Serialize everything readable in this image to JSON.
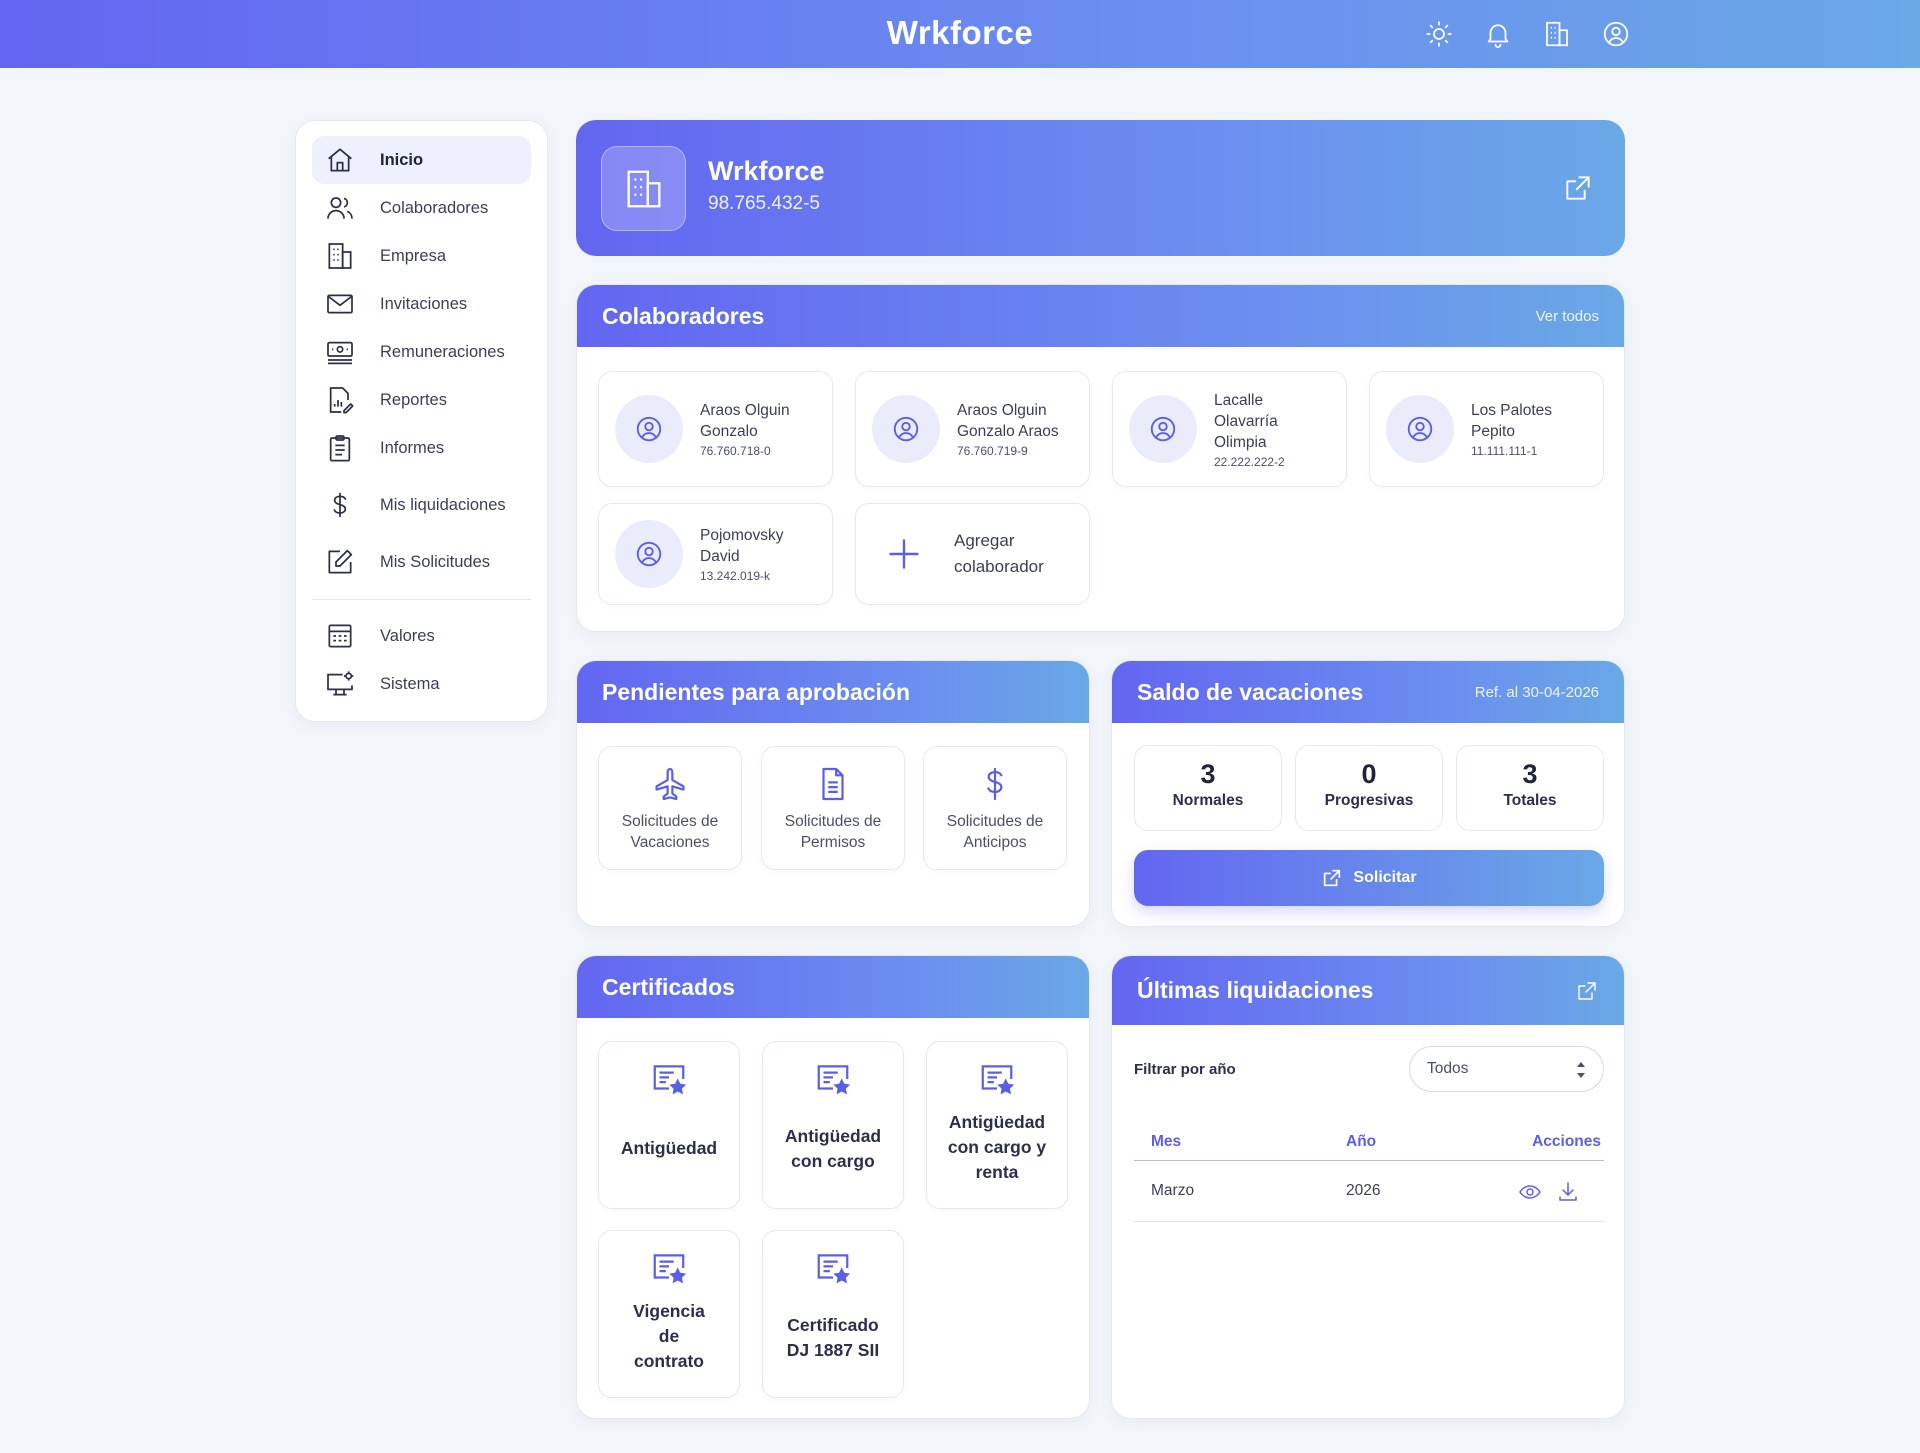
{
  "app": {
    "title": "Wrkforce"
  },
  "topbar_icons": [
    "sun-icon",
    "bell-icon",
    "building-icon",
    "user-circle-icon"
  ],
  "sidebar": {
    "items": [
      {
        "label": "Inicio",
        "icon": "home-icon",
        "active": true
      },
      {
        "label": "Colaboradores",
        "icon": "users-icon"
      },
      {
        "label": "Empresa",
        "icon": "building-icon"
      },
      {
        "label": "Invitaciones",
        "icon": "mail-icon"
      },
      {
        "label": "Remuneraciones",
        "icon": "cash-icon"
      },
      {
        "label": "Reportes",
        "icon": "report-icon"
      },
      {
        "label": "Informes",
        "icon": "clipboard-icon"
      },
      {
        "label": "Mis liquidaciones",
        "icon": "dollar-icon"
      },
      {
        "label": "Mis Solicitudes",
        "icon": "edit-icon"
      }
    ],
    "secondary": [
      {
        "label": "Valores",
        "icon": "calculator-icon"
      },
      {
        "label": "Sistema",
        "icon": "monitor-settings-icon"
      }
    ]
  },
  "company": {
    "name": "Wrkforce",
    "rut": "98.765.432-5"
  },
  "colaboradores": {
    "title": "Colaboradores",
    "link": "Ver todos",
    "people": [
      {
        "name": "Araos Olguin Gonzalo",
        "rut": "76.760.718-0"
      },
      {
        "name": "Araos Olguin Gonzalo Araos",
        "rut": "76.760.719-9"
      },
      {
        "name": "Lacalle Olavarría Olimpia",
        "rut": "22.222.222-2"
      },
      {
        "name": "Los Palotes Pepito",
        "rut": "11.111.111-1"
      },
      {
        "name": "Pojomovsky David",
        "rut": "13.242.019-k"
      }
    ],
    "add_label": "Agregar colaborador"
  },
  "pendientes": {
    "title": "Pendientes para aprobación",
    "items": [
      {
        "label": "Solicitudes de Vacaciones",
        "icon": "plane-icon"
      },
      {
        "label": "Solicitudes de Permisos",
        "icon": "document-icon"
      },
      {
        "label": "Solicitudes de Anticipos",
        "icon": "dollar-icon"
      }
    ]
  },
  "vacaciones": {
    "title": "Saldo de vacaciones",
    "ref": "Ref. al 30-04-2026",
    "stats": [
      {
        "value": "3",
        "label": "Normales"
      },
      {
        "value": "0",
        "label": "Progresivas"
      },
      {
        "value": "3",
        "label": "Totales"
      }
    ],
    "button": "Solicitar"
  },
  "certificados": {
    "title": "Certificados",
    "items": [
      {
        "label": "Antigüedad"
      },
      {
        "label": "Antigüedad con cargo"
      },
      {
        "label": "Antigüedad con cargo y renta"
      },
      {
        "label": "Vigencia de contrato"
      },
      {
        "label": "Certificado DJ 1887 SII"
      }
    ]
  },
  "liquidaciones": {
    "title": "Últimas liquidaciones",
    "filter_label": "Filtrar por año",
    "filter_value": "Todos",
    "columns": [
      "Mes",
      "Año",
      "Acciones"
    ],
    "rows": [
      {
        "mes": "Marzo",
        "anio": "2026"
      }
    ]
  },
  "colors": {
    "accent": "#6366f1",
    "accent_end": "#6aa8e6",
    "background": "#f2f5fa"
  }
}
